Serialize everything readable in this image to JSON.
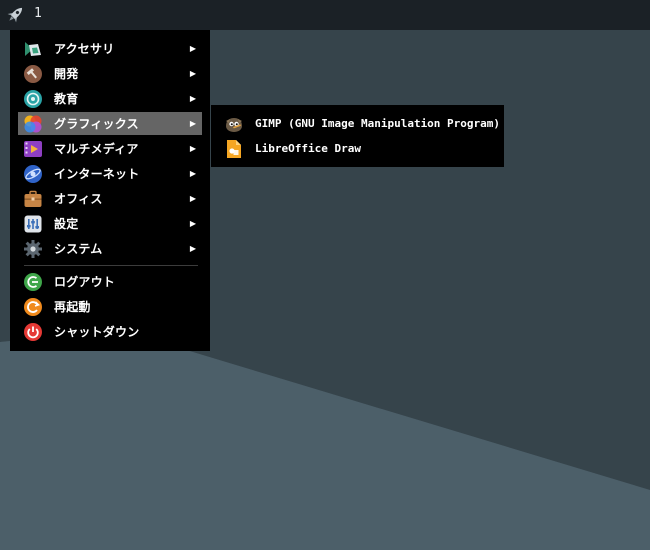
{
  "panel": {
    "launcher_icon": "rocket-icon",
    "workspace_label": "1"
  },
  "main_menu": {
    "items": [
      {
        "label": "アクセサリ",
        "icon": "accessories-icon",
        "submenu": true
      },
      {
        "label": "開発",
        "icon": "development-icon",
        "submenu": true
      },
      {
        "label": "教育",
        "icon": "education-icon",
        "submenu": true
      },
      {
        "label": "グラフィックス",
        "icon": "graphics-icon",
        "submenu": true,
        "highlighted": true
      },
      {
        "label": "マルチメディア",
        "icon": "multimedia-icon",
        "submenu": true
      },
      {
        "label": "インターネット",
        "icon": "internet-icon",
        "submenu": true
      },
      {
        "label": "オフィス",
        "icon": "office-icon",
        "submenu": true
      },
      {
        "label": "設定",
        "icon": "settings-icon",
        "submenu": true
      },
      {
        "label": "システム",
        "icon": "system-icon",
        "submenu": true
      }
    ],
    "session_items": [
      {
        "label": "ログアウト",
        "icon": "logout-icon"
      },
      {
        "label": "再起動",
        "icon": "reboot-icon"
      },
      {
        "label": "シャットダウン",
        "icon": "shutdown-icon"
      }
    ],
    "arrow_glyph": "▶"
  },
  "sub_menu": {
    "items": [
      {
        "label": "GIMP (GNU Image Manipulation Program)",
        "icon": "gimp-icon"
      },
      {
        "label": "LibreOffice Draw",
        "icon": "libreoffice-draw-icon"
      }
    ]
  },
  "colors": {
    "panel": "#1b2126",
    "menu_bg": "#000000",
    "highlight": "#656565",
    "desktop_dark": "#2f3a40",
    "desktop_light": "#4a5d66"
  }
}
